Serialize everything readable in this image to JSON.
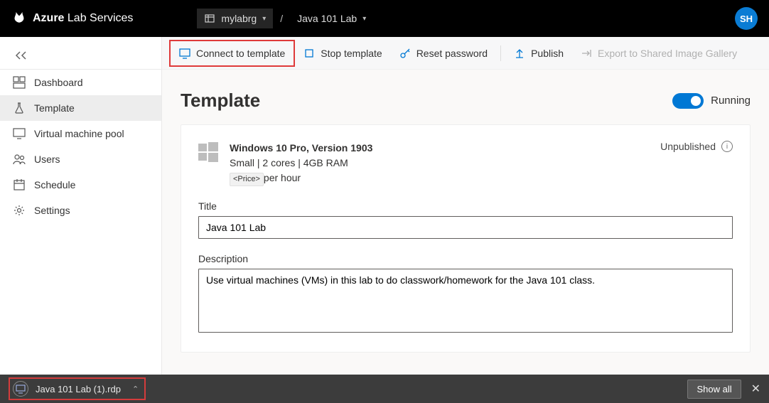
{
  "header": {
    "brand_bold": "Azure",
    "brand_rest": "Lab Services",
    "crumb1": "mylabrg",
    "crumb2": "Java 101 Lab",
    "avatar_initials": "SH"
  },
  "sidebar": {
    "items": [
      {
        "label": "Dashboard"
      },
      {
        "label": "Template"
      },
      {
        "label": "Virtual machine pool"
      },
      {
        "label": "Users"
      },
      {
        "label": "Schedule"
      },
      {
        "label": "Settings"
      }
    ]
  },
  "toolbar": {
    "connect": "Connect to template",
    "stop": "Stop template",
    "reset": "Reset password",
    "publish": "Publish",
    "export": "Export to Shared Image Gallery"
  },
  "template": {
    "title_heading": "Template",
    "running_label": "Running",
    "os_name": "Windows 10 Pro, Version 1903",
    "size_line": "Small | 2 cores | 4GB RAM",
    "price_badge": "<Price>",
    "price_suffix": "per hour",
    "pub_status": "Unpublished",
    "title_label": "Title",
    "title_value": "Java 101 Lab",
    "desc_label": "Description",
    "desc_value": "Use virtual machines (VMs) in this lab to do classwork/homework for the Java 101 class."
  },
  "downloads": {
    "file": "Java 101 Lab (1).rdp",
    "show_all": "Show all"
  }
}
